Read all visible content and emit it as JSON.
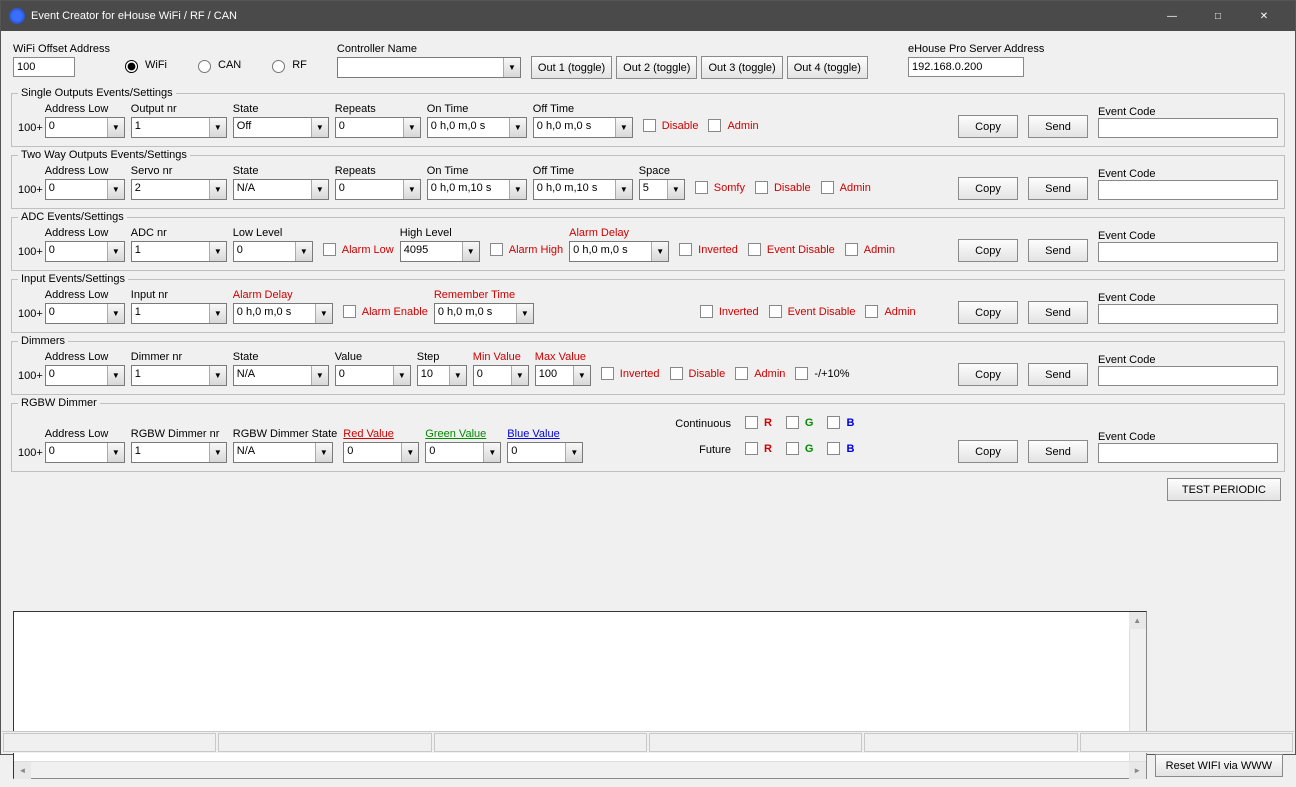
{
  "window": {
    "title": "Event Creator for eHouse WiFi / RF / CAN"
  },
  "top": {
    "wifi_offset_label": "WiFi Offset Address",
    "wifi_offset_value": "100",
    "radio_wifi": "WiFi",
    "radio_can": "CAN",
    "radio_rf": "RF",
    "controller_name_label": "Controller Name",
    "controller_name_value": "",
    "out1": "Out 1 (toggle)",
    "out2": "Out 2 (toggle)",
    "out3": "Out 3 (toggle)",
    "out4": "Out 4 (toggle)",
    "server_label": "eHouse Pro Server Address",
    "server_value": "192.168.0.200"
  },
  "labels": {
    "address_low": "Address Low",
    "output_nr": "Output nr",
    "state": "State",
    "repeats": "Repeats",
    "on_time": "On Time",
    "off_time": "Off Time",
    "disable": "Disable",
    "admin": "Admin",
    "copy": "Copy",
    "send": "Send",
    "event_code": "Event Code",
    "servo_nr": "Servo nr",
    "space": "Space",
    "somfy": "Somfy",
    "adc_nr": "ADC nr",
    "low_level": "Low Level",
    "alarm_low": "Alarm Low",
    "high_level": "High Level",
    "alarm_high": "Alarm High",
    "alarm_delay": "Alarm Delay",
    "inverted": "Inverted",
    "event_disable": "Event Disable",
    "input_nr": "Input nr",
    "alarm_enable": "Alarm Enable",
    "remember_time": "Remember Time",
    "dimmer_nr": "Dimmer nr",
    "value": "Value",
    "step": "Step",
    "min_value": "Min Value",
    "max_value": "Max Value",
    "pm10": "-/+10%",
    "rgbw_dimmer_nr": "RGBW Dimmer nr",
    "rgbw_dimmer_state": "RGBW Dimmer State",
    "red_value": "Red Value",
    "green_value": "Green Value",
    "blue_value": "Blue Value",
    "continuous": "Continuous",
    "future": "Future",
    "r": "R",
    "g": "G",
    "b": "B",
    "prefix100": "100+",
    "test_periodic": "TEST PERIODIC",
    "reset_wifi": "Reset WIFI via WWW"
  },
  "single": {
    "legend": "Single Outputs Events/Settings",
    "addr": "0",
    "output": "1",
    "state": "Off",
    "repeats": "0",
    "on_time": "0 h,0 m,0 s",
    "off_time": "0 h,0 m,0 s",
    "event_code": ""
  },
  "twoway": {
    "legend": "Two Way Outputs Events/Settings",
    "addr": "0",
    "servo": "2",
    "state": "N/A",
    "repeats": "0",
    "on_time": "0 h,0 m,10 s",
    "off_time": "0 h,0 m,10 s",
    "space": "5",
    "event_code": ""
  },
  "adc": {
    "legend": "ADC Events/Settings",
    "addr": "0",
    "adc": "1",
    "low_level": "0",
    "high_level": "4095",
    "alarm_delay": "0 h,0 m,0 s",
    "event_code": ""
  },
  "input": {
    "legend": "Input Events/Settings",
    "addr": "0",
    "input": "1",
    "alarm_delay": "0 h,0 m,0 s",
    "remember_time": "0 h,0 m,0 s",
    "event_code": ""
  },
  "dimmer": {
    "legend": "Dimmers",
    "addr": "0",
    "dimmer": "1",
    "state": "N/A",
    "value": "0",
    "step": "10",
    "min": "0",
    "max": "100",
    "event_code": ""
  },
  "rgbw": {
    "legend": "RGBW Dimmer",
    "addr": "0",
    "dimmer": "1",
    "state": "N/A",
    "red": "0",
    "green": "0",
    "blue": "0",
    "event_code": ""
  }
}
